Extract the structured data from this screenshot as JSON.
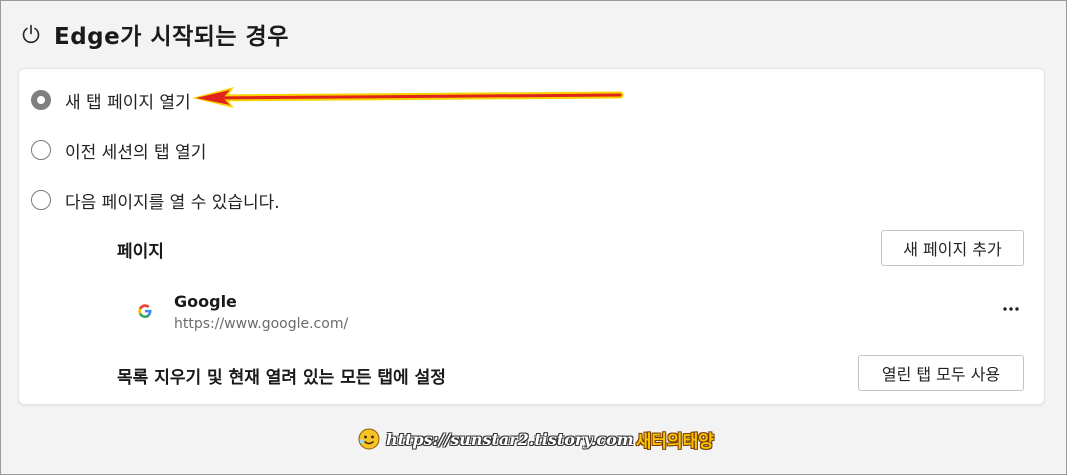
{
  "header": {
    "title": "Edge가 시작되는 경우",
    "icon": "power-icon"
  },
  "startup_options": [
    {
      "label": "새 탭 페이지 열기",
      "checked": true
    },
    {
      "label": "이전 세션의 탭 열기",
      "checked": false
    },
    {
      "label": "다음 페이지를 열 수 있습니다.",
      "checked": false
    }
  ],
  "pages": {
    "label": "페이지",
    "add_button": "새 페이지 추가",
    "items": [
      {
        "name": "Google",
        "url": "https://www.google.com/",
        "icon": "google-g-icon"
      }
    ],
    "more_icon": "more-horizontal-icon"
  },
  "clear_row": {
    "label": "목록 지우기 및 현재 열려 있는 모든 탭에 설정",
    "button": "열린 탭 모두 사용"
  },
  "annotation": {
    "arrow_color": "#e2231a",
    "arrow_outline": "#f5d400"
  },
  "watermark": {
    "url": "https://sunstar2.tistory.com",
    "name": "새터의태양"
  }
}
